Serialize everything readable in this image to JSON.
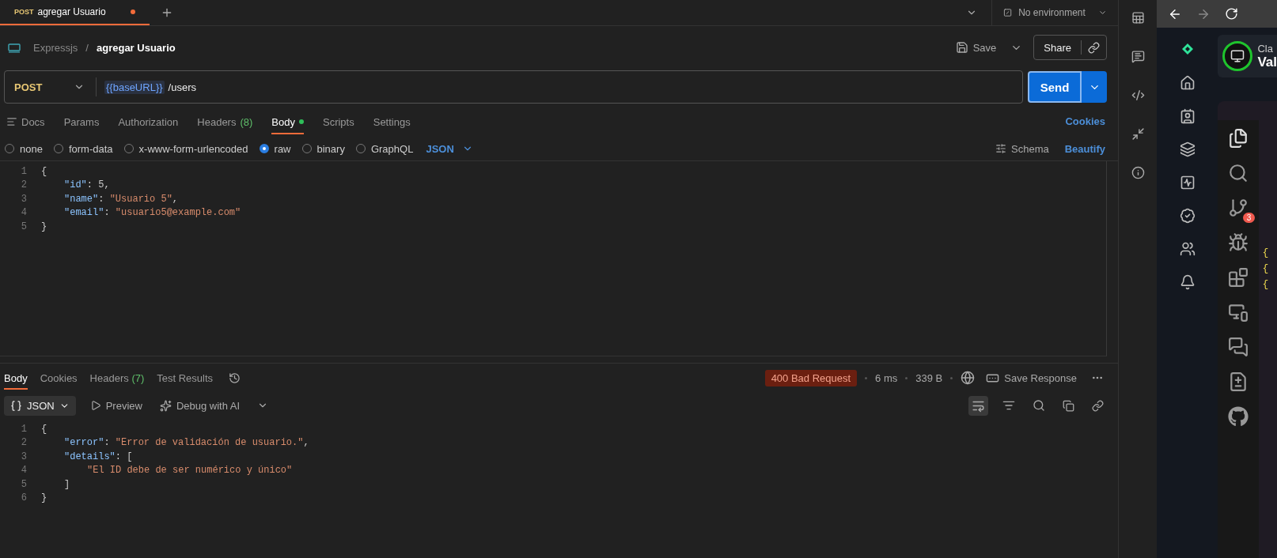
{
  "tabs": [
    {
      "method": "POST",
      "label": "agregar Usuario",
      "unsaved": true,
      "selected": true
    }
  ],
  "environment": "No environment",
  "breadcrumb": {
    "collection": "Expressjs",
    "separator": "/",
    "request": "agregar Usuario"
  },
  "actions": {
    "save": "Save",
    "share": "Share"
  },
  "request": {
    "method": "POST",
    "url_variable": "{{baseURL}}",
    "url_path": "/users",
    "send": "Send"
  },
  "request_tabs": [
    {
      "label": "Docs",
      "selected": false,
      "dot": false
    },
    {
      "label": "Params",
      "selected": false,
      "dot": false
    },
    {
      "label": "Authorization",
      "selected": false,
      "dot": false
    },
    {
      "label": "Headers",
      "count": "(8)",
      "selected": false,
      "dot": false
    },
    {
      "label": "Body",
      "selected": true,
      "dot": true
    },
    {
      "label": "Scripts",
      "selected": false,
      "dot": false
    },
    {
      "label": "Settings",
      "selected": false,
      "dot": false
    }
  ],
  "cookies": "Cookies",
  "body_types": [
    {
      "label": "none",
      "selected": false
    },
    {
      "label": "form-data",
      "selected": false
    },
    {
      "label": "x-www-form-urlencoded",
      "selected": false
    },
    {
      "label": "raw",
      "selected": true
    },
    {
      "label": "binary",
      "selected": false
    },
    {
      "label": "GraphQL",
      "selected": false
    }
  ],
  "body_format": "JSON",
  "schema": "Schema",
  "beautify": "Beautify",
  "request_body": [
    {
      "number": "1",
      "kind": "root",
      "tokens": [
        {
          "t": "{",
          "kind": "punct"
        }
      ]
    },
    {
      "number": "2",
      "kind": "inner",
      "tokens": [
        {
          "t": "\"id\"",
          "kind": "key"
        },
        {
          "t": ": ",
          "kind": "punct"
        },
        {
          "t": "5",
          "kind": "number"
        },
        {
          "t": ",",
          "kind": "punct"
        }
      ]
    },
    {
      "number": "3",
      "kind": "inner",
      "tokens": [
        {
          "t": "\"name\"",
          "kind": "key"
        },
        {
          "t": ": ",
          "kind": "punct"
        },
        {
          "t": "\"Usuario 5\"",
          "kind": "string"
        },
        {
          "t": ",",
          "kind": "punct"
        }
      ]
    },
    {
      "number": "4",
      "kind": "inner",
      "tokens": [
        {
          "t": "\"email\"",
          "kind": "key"
        },
        {
          "t": ": ",
          "kind": "punct"
        },
        {
          "t": "\"usuario5@example.com\"",
          "kind": "string"
        }
      ]
    },
    {
      "number": "5",
      "kind": "root",
      "tokens": [
        {
          "t": "}",
          "kind": "punct"
        }
      ]
    }
  ],
  "response_tabs": [
    {
      "label": "Body",
      "selected": true
    },
    {
      "label": "Cookies",
      "selected": false
    },
    {
      "label": "Headers",
      "count": "(7)",
      "selected": false
    },
    {
      "label": "Test Results",
      "selected": false
    }
  ],
  "status": "400 Bad Request",
  "time": "6 ms",
  "size": "339 B",
  "save_response": "Save Response",
  "response_view": {
    "format": "JSON",
    "preview": "Preview",
    "debug": "Debug with AI"
  },
  "response_body": [
    {
      "number": "1",
      "kind": "root",
      "tokens": [
        {
          "t": "{",
          "kind": "punct"
        }
      ]
    },
    {
      "number": "2",
      "kind": "inner",
      "tokens": [
        {
          "t": "\"error\"",
          "kind": "key"
        },
        {
          "t": ": ",
          "kind": "punct"
        },
        {
          "t": "\"Error de validación de usuario.\"",
          "kind": "string"
        },
        {
          "t": ",",
          "kind": "punct"
        }
      ]
    },
    {
      "number": "3",
      "kind": "inner",
      "tokens": [
        {
          "t": "\"details\"",
          "kind": "key"
        },
        {
          "t": ": [",
          "kind": "punct"
        }
      ]
    },
    {
      "number": "4",
      "kind": "nested",
      "tokens": [
        {
          "t": "\"El ID debe de ser numérico y único\"",
          "kind": "string"
        }
      ]
    },
    {
      "number": "5",
      "kind": "inner",
      "tokens": [
        {
          "t": "]",
          "kind": "punct"
        }
      ]
    },
    {
      "number": "6",
      "kind": "root",
      "tokens": [
        {
          "t": "}",
          "kind": "punct"
        }
      ]
    }
  ],
  "browser": {
    "card_title": "Cla",
    "card_subtitle": "Val",
    "scm_badge": "3",
    "code_fragments": [
      "{",
      "{",
      "{"
    ]
  }
}
